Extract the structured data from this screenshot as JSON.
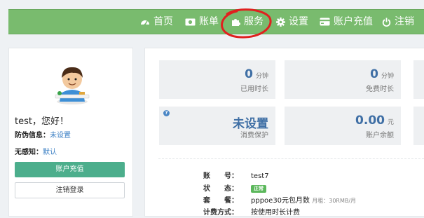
{
  "nav": {
    "items": [
      {
        "label": "首页",
        "icon": "dashboard-icon"
      },
      {
        "label": "账单",
        "icon": "money-icon"
      },
      {
        "label": "服务",
        "icon": "puzzle-icon"
      },
      {
        "label": "设置",
        "icon": "gear-icon"
      },
      {
        "label": "账户充值",
        "icon": "credit-card-icon"
      },
      {
        "label": "注销",
        "icon": "power-icon"
      }
    ],
    "annotation_color": "#e0201f"
  },
  "profile": {
    "greeting": "test，您好！",
    "anti_fraud_label": "防伪信息：",
    "anti_fraud_value": "未设置",
    "no_sense_label": "无感知：",
    "no_sense_value": "默认",
    "recharge_button": "账户充值",
    "logout_button": "注销登录"
  },
  "stats": {
    "used_duration": {
      "value": "0",
      "unit": "分钟",
      "label": "已用时长"
    },
    "free_duration": {
      "value": "0",
      "unit": "分钟",
      "label": "免费时长"
    },
    "consumption_protection": {
      "value": "未设置",
      "label": "消费保护",
      "help": "?"
    },
    "balance": {
      "value": "0.00",
      "unit": "元",
      "label": "账户余额"
    }
  },
  "account": {
    "rows": [
      {
        "key": "账　　号：",
        "value": "test7"
      },
      {
        "key": "状　　态：",
        "badge": "正常"
      },
      {
        "key": "套　　餐：",
        "value": "pppoe30元包月数",
        "extra": "月租：30RMB/月"
      },
      {
        "key": "计费方式：",
        "value": "按使用时长计费"
      }
    ]
  },
  "colors": {
    "topbar": "#79bb6e",
    "accent_button": "#4cae8c",
    "stat_number": "#3f6fa5",
    "status_ok": "#5cb85c"
  }
}
